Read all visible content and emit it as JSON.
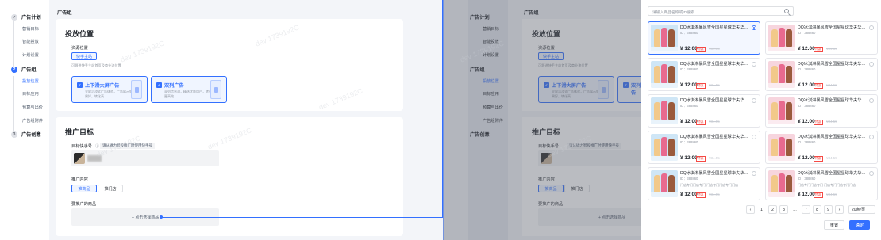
{
  "watermark": "dev 1739192C",
  "left": {
    "nav": {
      "groups": [
        {
          "num": "✓",
          "label": "广告计划",
          "subs": [
            "营销目标",
            "智能投放",
            "计划设置"
          ]
        },
        {
          "num": "2",
          "label": "广告组",
          "subs": [
            "投放位置",
            "目标应用",
            "预算与出价",
            "广告组附件"
          ]
        },
        {
          "num": "3",
          "label": "广告创意",
          "subs": []
        }
      ],
      "active_sub": "投放位置"
    },
    "breadcrumb": "广告组",
    "placement": {
      "title": "投放位置",
      "resource_label": "资源位置",
      "resource_btn": "快手主站",
      "resource_hint": "可跟进快手主站首页及商业流位置",
      "cards": [
        {
          "title": "上下滑大屏广告",
          "desc": "全屏沉浸式广告体验，广告展示效果好，转化高"
        },
        {
          "title": "双列广告",
          "desc": "双列信息流，精选优质用户，转化更高效"
        }
      ]
    },
    "target": {
      "title": "推广目标",
      "account_label": "目标快手号",
      "account_hint": "请从磁力智投推广时使用快手号",
      "content_label": "推广内容",
      "content_btns": [
        "推商品",
        "推门店"
      ],
      "product_label": "要推广的商品",
      "select_btn": "+ 点击选择商品"
    }
  },
  "drawer": {
    "search_placeholder": "请输入商品名称或ID搜索",
    "products": [
      {
        "title": "DQ冰淇淋暴风雪全国星星球华夫华夫饼",
        "id": "ID：388860",
        "desc": "",
        "price": "¥ 12.00",
        "tag": "特惠",
        "old": "¥34.55",
        "selected": true
      },
      {
        "title": "DQ冰淇淋暴风雪全国星星球华夫华夫饼",
        "id": "ID：388860",
        "desc": "",
        "price": "¥ 12.00",
        "tag": "特惠",
        "old": "¥34.55",
        "selected": false
      },
      {
        "title": "DQ冰淇淋暴风雪全国星星球华夫华夫饼",
        "id": "ID：388860",
        "desc": "",
        "price": "¥ 12.00",
        "tag": "特惠",
        "old": "¥34.55",
        "selected": false
      },
      {
        "title": "DQ冰淇淋暴风雪全国星星球华夫华夫饼",
        "id": "ID：388860",
        "desc": "",
        "price": "¥ 12.00",
        "tag": "特惠",
        "old": "¥34.55",
        "selected": false
      },
      {
        "title": "DQ冰淇淋暴风雪全国星星球华夫华夫饼",
        "id": "ID：388860",
        "desc": "",
        "price": "¥ 12.00",
        "tag": "特惠",
        "old": "¥34.55",
        "selected": false
      },
      {
        "title": "DQ冰淇淋暴风雪全国星星球华夫华夫饼",
        "id": "ID：388860",
        "desc": "",
        "price": "¥ 12.00",
        "tag": "特惠",
        "old": "¥34.55",
        "selected": false
      },
      {
        "title": "DQ冰淇淋暴风雪全国星星球华夫华夫饼",
        "id": "ID：388860",
        "desc": "",
        "price": "¥ 12.00",
        "tag": "特惠",
        "old": "¥34.55",
        "selected": false
      },
      {
        "title": "DQ冰淇淋暴风雪全国星星球华夫华夫饼",
        "id": "ID：388860",
        "desc": "",
        "price": "¥ 12.00",
        "tag": "特惠",
        "old": "¥34.55",
        "selected": false
      },
      {
        "title": "DQ冰淇淋暴风雪全国星星球华夫华夫饼",
        "id": "ID：388860",
        "desc": "门店专门门店专门 门店专门门店专门门店",
        "price": "¥ 12.00",
        "tag": "特惠",
        "old": "¥34.55",
        "selected": false
      },
      {
        "title": "DQ冰淇淋暴风雪全国星星球华夫华夫饼",
        "id": "ID：388860",
        "desc": "门店专门门店专门 门店专门门店专门门店",
        "price": "¥ 12.00",
        "tag": "特惠",
        "old": "¥34.55",
        "selected": false
      }
    ],
    "pagination": {
      "prev": "‹",
      "pages": [
        "1",
        "2",
        "3",
        "…",
        "7",
        "8",
        "9"
      ],
      "next": "›",
      "size": "20条/页"
    },
    "footer": {
      "reset": "重置",
      "confirm": "确定"
    },
    "colors": {
      "accent": "#3370ff",
      "price_tag": "#f54a45"
    }
  }
}
